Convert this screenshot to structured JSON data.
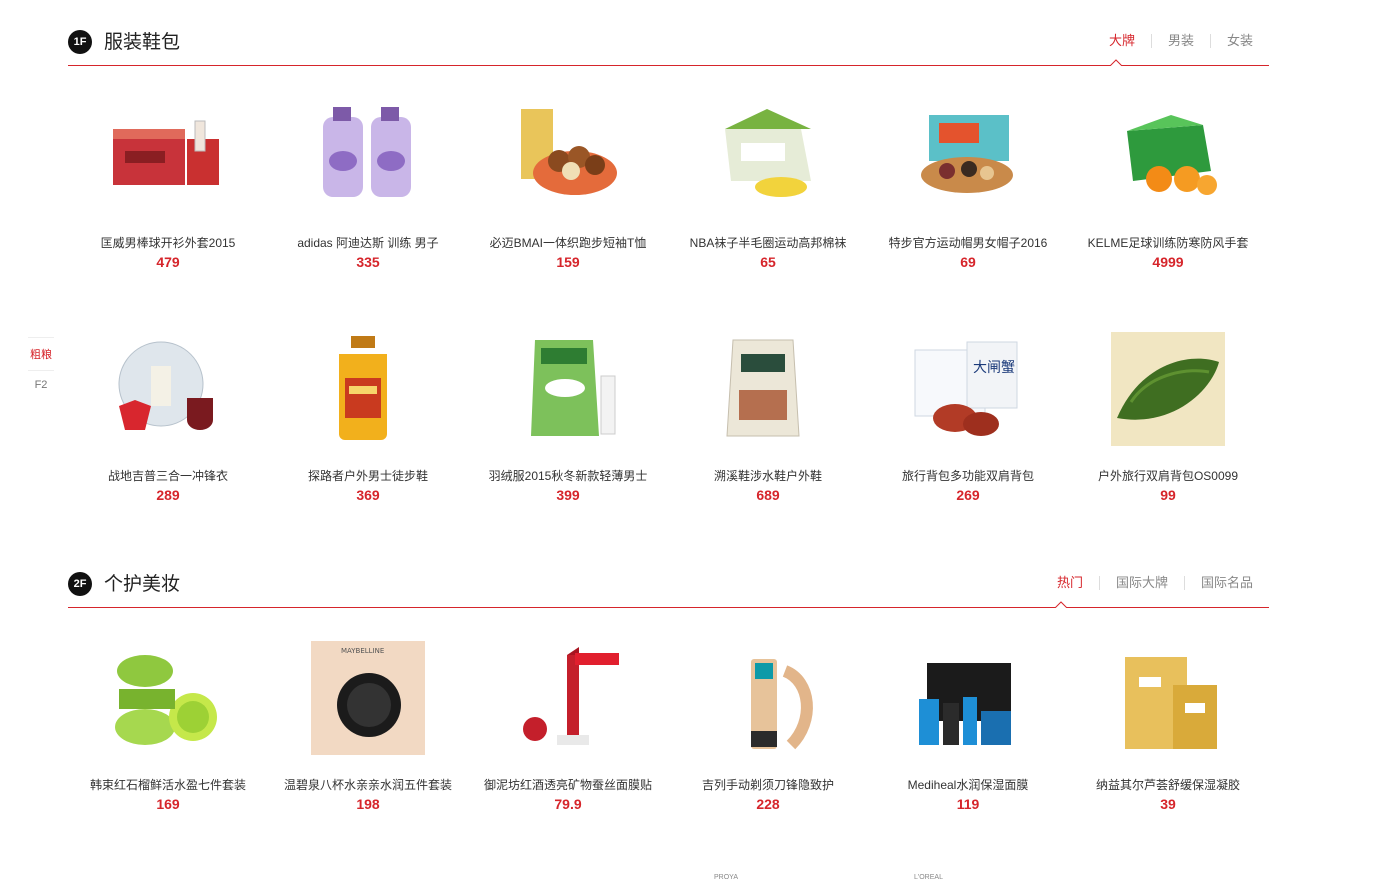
{
  "sidenav": {
    "items": [
      "粗粮",
      "F2"
    ]
  },
  "floor1": {
    "badge": "1F",
    "title": "服装鞋包",
    "tabs": [
      "大牌",
      "男装",
      "女装"
    ],
    "products": [
      {
        "name": "匡威男棒球开衫外套2015",
        "price": "479",
        "icon": "liquor-box-image"
      },
      {
        "name": "adidas 阿迪达斯 训练 男子",
        "price": "335",
        "icon": "detergent-bottles-image"
      },
      {
        "name": "必迈BMAI一体织跑步短袖T恤",
        "price": "159",
        "icon": "nuts-bowl-image"
      },
      {
        "name": "NBA袜子半毛圈运动高邦棉袜",
        "price": "65",
        "icon": "corn-box-image"
      },
      {
        "name": "特步官方运动帽男女帽子2016",
        "price": "69",
        "icon": "mixed-nuts-image"
      },
      {
        "name": "KELME足球训练防寒防风手套",
        "price": "4999",
        "icon": "oranges-box-image"
      },
      {
        "name": "战地吉普三合一冲锋衣",
        "price": "289",
        "icon": "tea-cake-image"
      },
      {
        "name": "探路者户外男士徒步鞋",
        "price": "369",
        "icon": "oil-bottle-image"
      },
      {
        "name": "羽绒服2015秋冬新款轻薄男士",
        "price": "399",
        "icon": "milk-powder-image"
      },
      {
        "name": "溯溪鞋涉水鞋户外鞋",
        "price": "689",
        "icon": "rice-bag-image"
      },
      {
        "name": "旅行背包多功能双肩背包",
        "price": "269",
        "icon": "crab-box-image"
      },
      {
        "name": "户外旅行双肩背包OS0099",
        "price": "99",
        "icon": "green-tea-image"
      }
    ]
  },
  "floor2": {
    "badge": "2F",
    "title": "个护美妆",
    "tabs": [
      "热门",
      "国际大牌",
      "国际名品"
    ],
    "products": [
      {
        "name": "韩束红石榴鲜活水盈七件套装",
        "price": "169",
        "icon": "aloe-gel-image"
      },
      {
        "name": "温碧泉八杯水亲亲水润五件套装",
        "price": "198",
        "icon": "cushion-compact-image"
      },
      {
        "name": "御泥坊红酒透亮矿物蚕丝面膜贴",
        "price": "79.9",
        "icon": "lipstick-image"
      },
      {
        "name": "吉列手动剃须刀锋隐致护",
        "price": "228",
        "icon": "foundation-bottle-image"
      },
      {
        "name": "Mediheal水润保湿面膜",
        "price": "119",
        "icon": "men-skincare-set-image"
      },
      {
        "name": "纳益其尔芦荟舒缓保湿凝胶",
        "price": "39",
        "icon": "gold-mask-image"
      }
    ],
    "peek_labels": [
      "PROYA",
      "L'OREAL"
    ]
  },
  "colors": {
    "accent": "#d6252b",
    "badge": "#111111"
  }
}
